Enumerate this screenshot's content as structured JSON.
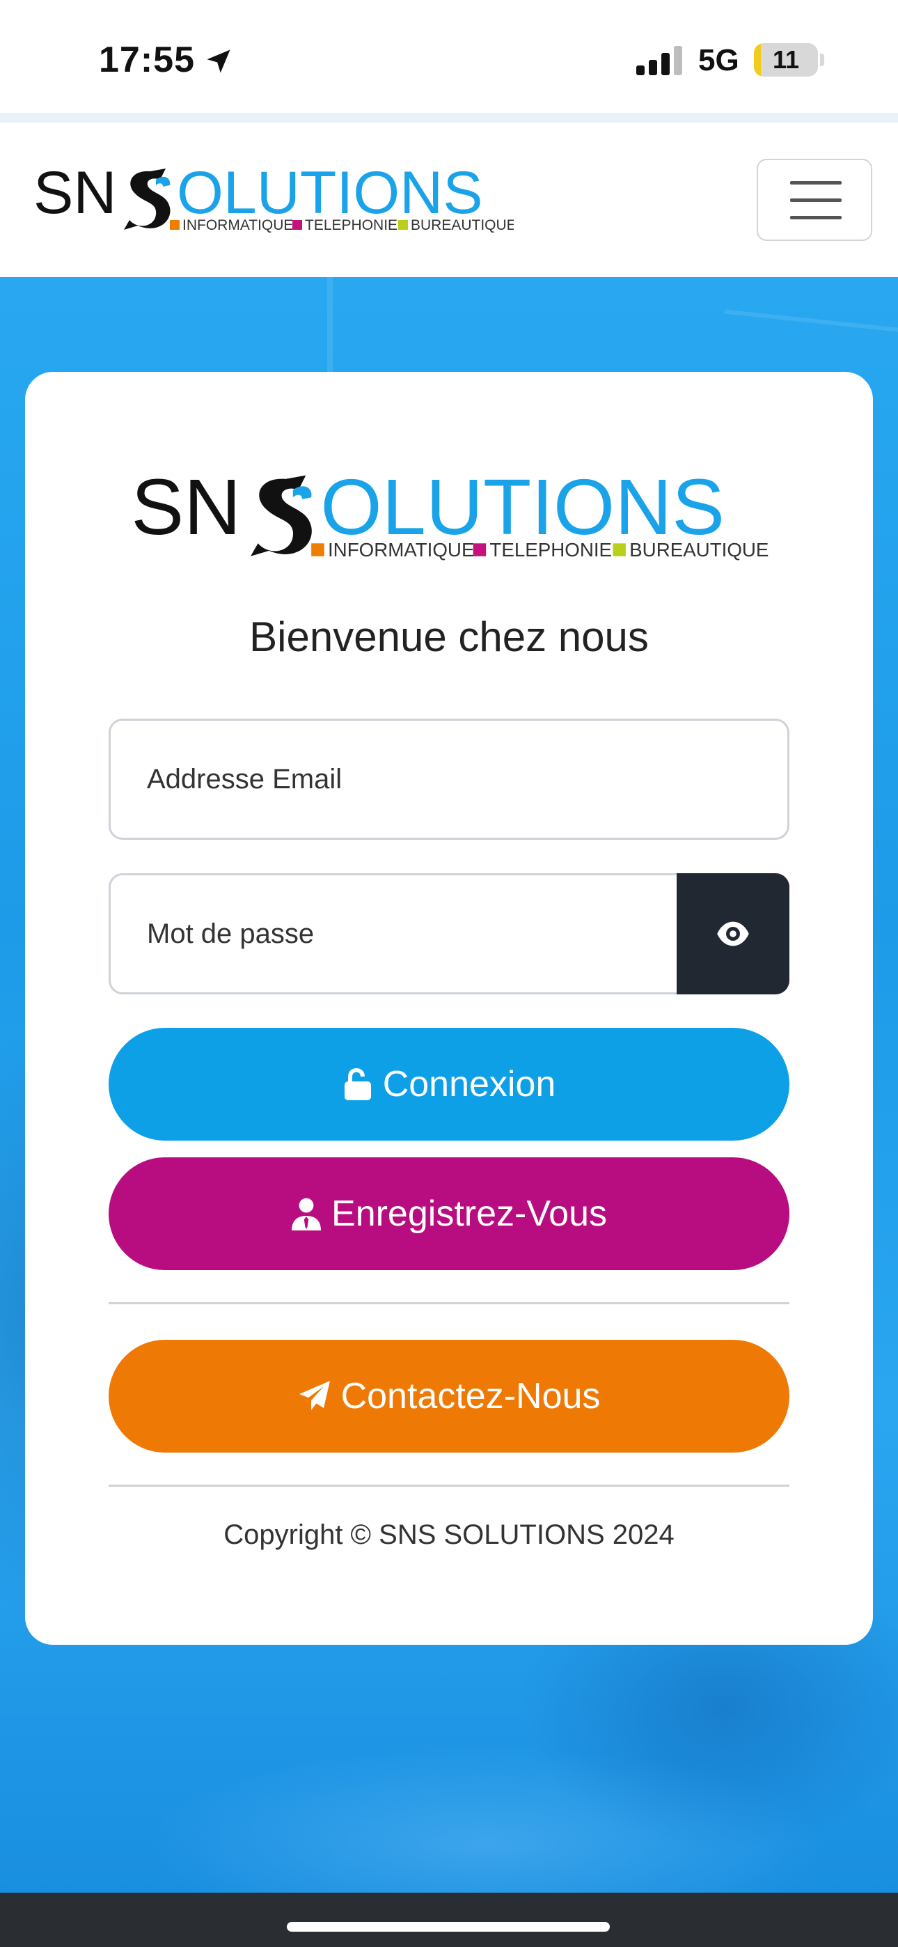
{
  "status_bar": {
    "time": "17:55",
    "network": "5G",
    "battery": "11",
    "battery_level": 0.11
  },
  "logo": {
    "brand_left": "SN",
    "brand_right": "OLUTIONS",
    "tag1": "INFORMATIQUE",
    "tag2": "TELEPHONIE",
    "tag3": "BUREAUTIQUE",
    "colors": {
      "dark": "#111111",
      "blue": "#1aa3e8",
      "orange": "#ef7d00",
      "magenta": "#c4117c",
      "green": "#b9cf1a"
    }
  },
  "navbar": {
    "menu_icon": "hamburger-menu-icon"
  },
  "login_card": {
    "title": "Bienvenue chez nous",
    "email_placeholder": "Addresse Email",
    "password_placeholder": "Mot de passe",
    "show_password_icon": "eye-icon",
    "login_button": "Connexion",
    "login_icon": "unlock-icon",
    "register_button": "Enregistrez-Vous",
    "register_icon": "user-tie-icon",
    "contact_button": "Contactez-Nous",
    "contact_icon": "paper-plane-icon",
    "copyright": "Copyright © SNS SOLUTIONS 2024"
  },
  "colors": {
    "accent_blue": "#0ea0e6",
    "accent_magenta": "#b80d80",
    "accent_orange": "#ee7a05",
    "background_blue": "#1d9be8"
  }
}
